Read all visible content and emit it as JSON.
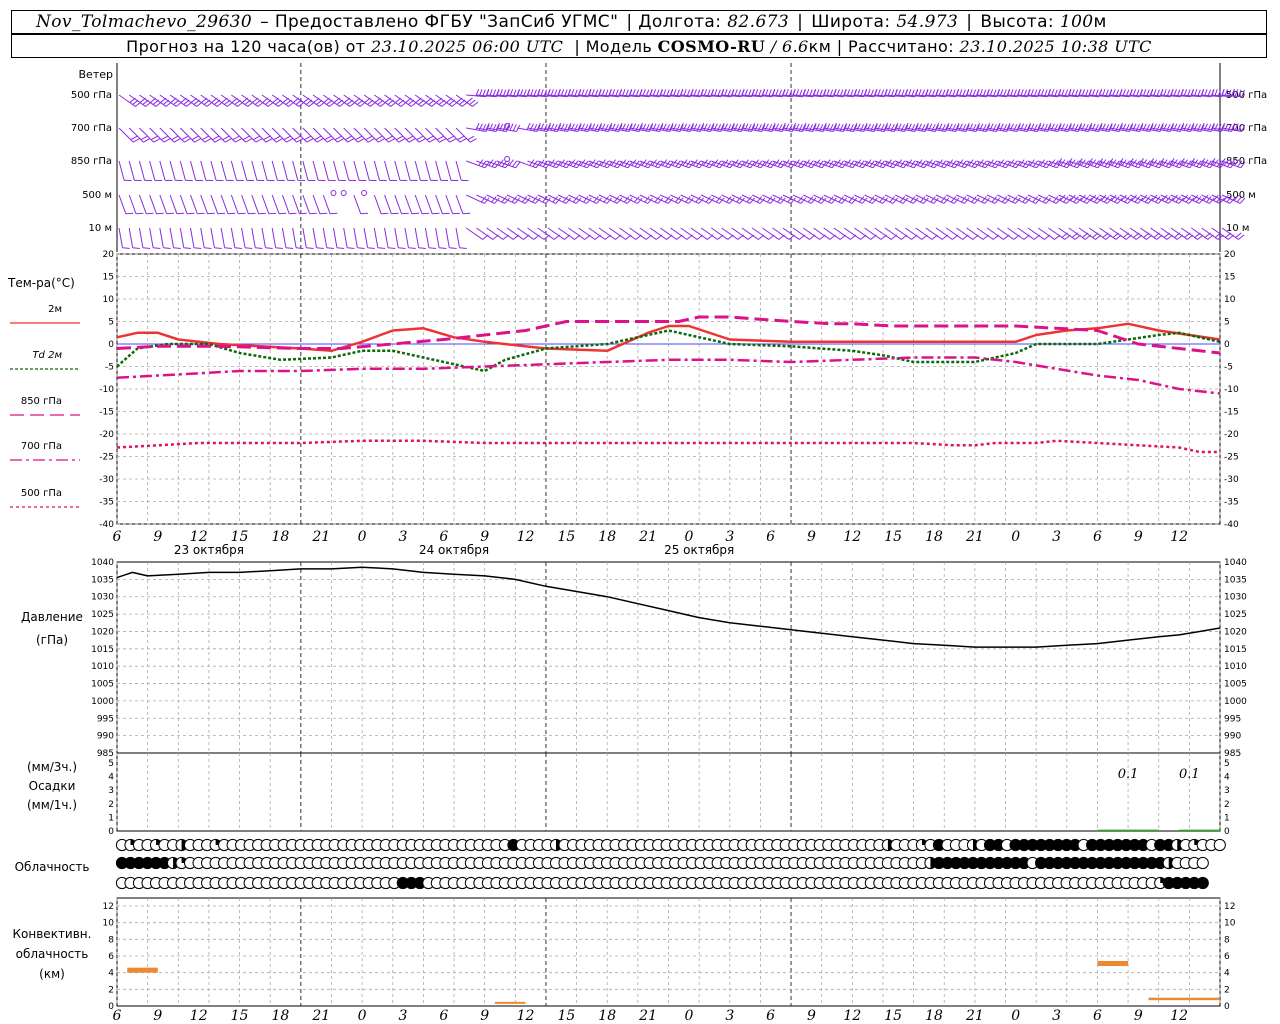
{
  "header": {
    "station": "Nov_Tolmachevo_29630",
    "provided_by": "– Предоставлено ФГБУ \"ЗапСиб УГМС\"",
    "lon_label": "Долгота:",
    "lon_value": "82.673",
    "lat_label": "Широта:",
    "lat_value": "54.973",
    "alt_label": "Высота:",
    "alt_value": "100",
    "alt_unit": "м",
    "forecast_label": "Прогноз на 120 часа(ов) от",
    "forecast_start": "23.10.2025 06:00 UTC",
    "model_label": "| Модель",
    "model_name": "COSMO-RU",
    "model_res": "/ 6.6",
    "model_res_unit": "км",
    "calc_label": "| Рассчитано:",
    "calc_time": "23.10.2025 10:38 UTC"
  },
  "time_axis": {
    "hour_labels": [
      "6",
      "9",
      "12",
      "15",
      "18",
      "21",
      "0",
      "3",
      "6",
      "9",
      "12",
      "15",
      "18",
      "21",
      "0",
      "3",
      "6",
      "9",
      "12",
      "15",
      "18",
      "21",
      "0",
      "3",
      "6",
      "9",
      "12"
    ],
    "day_labels": [
      {
        "hour": 9,
        "text": "23 октября"
      },
      {
        "hour": 33,
        "text": "24 октября"
      },
      {
        "hour": 57,
        "text": "25 октября"
      }
    ],
    "midnights": [
      18,
      42,
      66
    ]
  },
  "colors": {
    "wind": "#8a2be2",
    "t2m": "#ee3333",
    "td2m": "#0a6a0a",
    "t850": "#dd1188",
    "t700": "#dd1188",
    "t500": "#dd1166",
    "pressure": "#000000",
    "precip": "#22aa22",
    "conv": "#ee8833",
    "zero_line": "#4444ff",
    "grid": "#aaaaaa"
  },
  "wind_panel": {
    "title": "Ветер",
    "levels": [
      "500 гПа",
      "700 гПа",
      "850 гПа",
      "500 м",
      "10 м"
    ]
  },
  "temperature_panel": {
    "title": "Тем-ра(°C)",
    "legend": [
      {
        "label": "2м",
        "style": "solid"
      },
      {
        "label": "Td 2м",
        "style": "dotted"
      },
      {
        "label": "850 гПа",
        "style": "longdash"
      },
      {
        "label": "700 гПа",
        "style": "dashdot"
      },
      {
        "label": "500 гПа",
        "style": "finedash"
      }
    ],
    "yticks": [
      "20",
      "15",
      "10",
      "5",
      "0",
      "-5",
      "-10",
      "-15",
      "-20",
      "-25",
      "-30",
      "-35",
      "-40"
    ]
  },
  "pressure_panel": {
    "title_1": "Давление",
    "title_2": "(гПа)",
    "yticks": [
      "1040",
      "1035",
      "1030",
      "1025",
      "1020",
      "1015",
      "1010",
      "1005",
      "1000",
      "995",
      "990",
      "985"
    ]
  },
  "precip_panel": {
    "title_1": "(мм/3ч.)",
    "title_2": "Осадки",
    "title_3": "(мм/1ч.)",
    "yticks": [
      "5",
      "4",
      "3",
      "2",
      "1",
      "0"
    ],
    "annotations": [
      {
        "hour": 99,
        "text": "0.1"
      },
      {
        "hour": 105,
        "text": "0.1"
      }
    ]
  },
  "cloud_panel": {
    "title": "Облачность",
    "rows": {
      "high": "abaabaacaaabaaaaaaaaaaaaaaaaaaaaaaaaaaaaaaaaaadaaaacaaaaaaaaaaaaaaaaaaaaaaaaaaaaaaaaaaaaaacaaabadaaacaddaddddddddadddddddaddcabaaa",
      "mid": "ddddddcbaaaaaaaaaaaaaaaaaaaaaaaaaaaaaaaaaaaaaaaaaaaaaaaaaaaaaaaaaaaaaaaaaaaaaaaaaaaaaaaaaaaaaaacdddddddddddadddddddddddddddcaaaa",
      "low": "aaaaaaaaaaaaaaaaaaaaaaaaaaaaaaaaadddaaaaaaaaaaaaaaaaaaaaaaaaaaaaaaaaaaaaaaaaaaaaaaaaaaaaaaaaaaaaaaaaaaaaaaaaaaaaaaaaaaaaaabddddd"
    }
  },
  "conv_panel": {
    "title_1": "Конвективн.",
    "title_2": "облачность",
    "title_3": "(км)",
    "yticks": [
      "12",
      "10",
      "8",
      "6",
      "4",
      "2",
      "0"
    ]
  },
  "chart_data": [
    {
      "type": "line",
      "title": "Ветер",
      "levels": [
        "500 гПа",
        "700 гПа",
        "850 гПа",
        "500 м",
        "10 м"
      ],
      "note": "wind barbs (direction, speed)"
    },
    {
      "type": "line",
      "title": "Тем-ра(°C)",
      "ylim": [
        -40,
        20
      ],
      "x_unit": "hours from 23.10.2025 06:00 UTC",
      "series": [
        {
          "name": "2м",
          "points": [
            [
              0,
              1.5
            ],
            [
              2,
              2.5
            ],
            [
              4,
              2.5
            ],
            [
              6,
              1
            ],
            [
              10,
              0
            ],
            [
              14,
              -0.5
            ],
            [
              18,
              -1
            ],
            [
              21,
              -1.5
            ],
            [
              24,
              0.5
            ],
            [
              27,
              3
            ],
            [
              30,
              3.5
            ],
            [
              33,
              1.5
            ],
            [
              36,
              0.5
            ],
            [
              42,
              -1
            ],
            [
              48,
              -1.5
            ],
            [
              52,
              2.5
            ],
            [
              54,
              4
            ],
            [
              56,
              4
            ],
            [
              60,
              1
            ],
            [
              66,
              0.5
            ],
            [
              72,
              0.5
            ],
            [
              78,
              0.5
            ],
            [
              84,
              0.5
            ],
            [
              88,
              0.5
            ],
            [
              90,
              2
            ],
            [
              93,
              3
            ],
            [
              96,
              3.5
            ],
            [
              99,
              4.5
            ],
            [
              102,
              3
            ],
            [
              108,
              1
            ]
          ]
        },
        {
          "name": "Td 2м",
          "points": [
            [
              0,
              -5
            ],
            [
              2,
              -1
            ],
            [
              5,
              0
            ],
            [
              9,
              0
            ],
            [
              12,
              -2
            ],
            [
              16,
              -3.5
            ],
            [
              21,
              -3
            ],
            [
              24,
              -1.5
            ],
            [
              27,
              -1.5
            ],
            [
              30,
              -3
            ],
            [
              34,
              -5
            ],
            [
              36,
              -6
            ],
            [
              38,
              -3.5
            ],
            [
              42,
              -1
            ],
            [
              48,
              0
            ],
            [
              52,
              2
            ],
            [
              54,
              3
            ],
            [
              56,
              2
            ],
            [
              60,
              0
            ],
            [
              66,
              -0.5
            ],
            [
              72,
              -1.5
            ],
            [
              75,
              -2.5
            ],
            [
              78,
              -4
            ],
            [
              84,
              -4
            ],
            [
              88,
              -2
            ],
            [
              90,
              0
            ],
            [
              93,
              0
            ],
            [
              96,
              0
            ],
            [
              99,
              1
            ],
            [
              102,
              2
            ],
            [
              104,
              2.5
            ],
            [
              108,
              0.5
            ]
          ]
        },
        {
          "name": "850 гПа",
          "points": [
            [
              0,
              -1
            ],
            [
              4,
              -0.5
            ],
            [
              10,
              -0.5
            ],
            [
              18,
              -1
            ],
            [
              22,
              -1
            ],
            [
              27,
              0
            ],
            [
              32,
              1
            ],
            [
              36,
              2
            ],
            [
              40,
              3
            ],
            [
              44,
              5
            ],
            [
              48,
              5
            ],
            [
              52,
              5
            ],
            [
              55,
              5
            ],
            [
              57,
              6
            ],
            [
              60,
              6
            ],
            [
              63,
              5.5
            ],
            [
              66,
              5
            ],
            [
              70,
              4.5
            ],
            [
              72,
              4.5
            ],
            [
              76,
              4
            ],
            [
              80,
              4
            ],
            [
              84,
              4
            ],
            [
              88,
              4
            ],
            [
              92,
              3.5
            ],
            [
              96,
              3
            ],
            [
              100,
              0
            ],
            [
              104,
              -1
            ],
            [
              106,
              -1.5
            ],
            [
              108,
              -2
            ]
          ]
        },
        {
          "name": "700 гПа",
          "points": [
            [
              0,
              -7.5
            ],
            [
              4,
              -7
            ],
            [
              8,
              -6.5
            ],
            [
              12,
              -6
            ],
            [
              18,
              -6
            ],
            [
              24,
              -5.5
            ],
            [
              30,
              -5.5
            ],
            [
              36,
              -5
            ],
            [
              42,
              -4.5
            ],
            [
              48,
              -4
            ],
            [
              54,
              -3.5
            ],
            [
              60,
              -3.5
            ],
            [
              66,
              -4
            ],
            [
              72,
              -3.5
            ],
            [
              78,
              -3
            ],
            [
              84,
              -3
            ],
            [
              88,
              -4
            ],
            [
              92,
              -5.5
            ],
            [
              96,
              -7
            ],
            [
              100,
              -8
            ],
            [
              104,
              -10
            ],
            [
              108,
              -11
            ]
          ]
        },
        {
          "name": "500 гПа",
          "points": [
            [
              0,
              -23
            ],
            [
              4,
              -22.5
            ],
            [
              8,
              -22
            ],
            [
              12,
              -22
            ],
            [
              18,
              -22
            ],
            [
              24,
              -21.5
            ],
            [
              30,
              -21.5
            ],
            [
              36,
              -22
            ],
            [
              42,
              -22
            ],
            [
              48,
              -22
            ],
            [
              54,
              -22
            ],
            [
              60,
              -22
            ],
            [
              66,
              -22
            ],
            [
              72,
              -22
            ],
            [
              78,
              -22
            ],
            [
              82,
              -22.5
            ],
            [
              84,
              -22.5
            ],
            [
              86,
              -22
            ],
            [
              90,
              -22
            ],
            [
              92,
              -21.5
            ],
            [
              96,
              -22
            ],
            [
              100,
              -22.5
            ],
            [
              104,
              -23
            ],
            [
              106,
              -24
            ],
            [
              108,
              -24
            ]
          ]
        }
      ]
    },
    {
      "type": "line",
      "title": "Давление (гПа)",
      "ylim": [
        985,
        1040
      ],
      "series": [
        {
          "name": "Давление",
          "points": [
            [
              0,
              1035.5
            ],
            [
              1.5,
              1037
            ],
            [
              3,
              1036
            ],
            [
              6,
              1036.5
            ],
            [
              9,
              1037
            ],
            [
              12,
              1037
            ],
            [
              15,
              1037.5
            ],
            [
              18,
              1038
            ],
            [
              21,
              1038
            ],
            [
              24,
              1038.5
            ],
            [
              27,
              1038
            ],
            [
              30,
              1037
            ],
            [
              33,
              1036.5
            ],
            [
              36,
              1036
            ],
            [
              39,
              1035
            ],
            [
              42,
              1033
            ],
            [
              45,
              1031.5
            ],
            [
              48,
              1030
            ],
            [
              51,
              1028
            ],
            [
              54,
              1026
            ],
            [
              57,
              1024
            ],
            [
              60,
              1022.5
            ],
            [
              63,
              1021.5
            ],
            [
              66,
              1020.5
            ],
            [
              69,
              1019.5
            ],
            [
              72,
              1018.5
            ],
            [
              75,
              1017.5
            ],
            [
              78,
              1016.5
            ],
            [
              81,
              1016
            ],
            [
              84,
              1015.5
            ],
            [
              87,
              1015.5
            ],
            [
              90,
              1015.5
            ],
            [
              93,
              1016
            ],
            [
              96,
              1016.5
            ],
            [
              99,
              1017.5
            ],
            [
              102,
              1018.5
            ],
            [
              104,
              1019
            ],
            [
              106,
              1020
            ],
            [
              108,
              1021
            ]
          ]
        }
      ]
    },
    {
      "type": "bar",
      "title": "Осадки",
      "ylim": [
        0,
        5
      ],
      "bars": [
        {
          "from": 96,
          "to": 102,
          "value": 0.1
        },
        {
          "from": 104,
          "to": 108,
          "value": 0.1
        }
      ]
    },
    {
      "type": "bar",
      "title": "Конвективн. облачность (км)",
      "ylim": [
        0,
        12
      ],
      "bars": [
        {
          "from": 1,
          "to": 4,
          "bottom": 4,
          "top": 4.6
        },
        {
          "from": 37,
          "to": 40,
          "bottom": 0.3,
          "top": 0.5
        },
        {
          "from": 96,
          "to": 99,
          "bottom": 4.8,
          "top": 5.4
        },
        {
          "from": 101,
          "to": 108,
          "bottom": 0.7,
          "top": 1
        }
      ]
    }
  ]
}
